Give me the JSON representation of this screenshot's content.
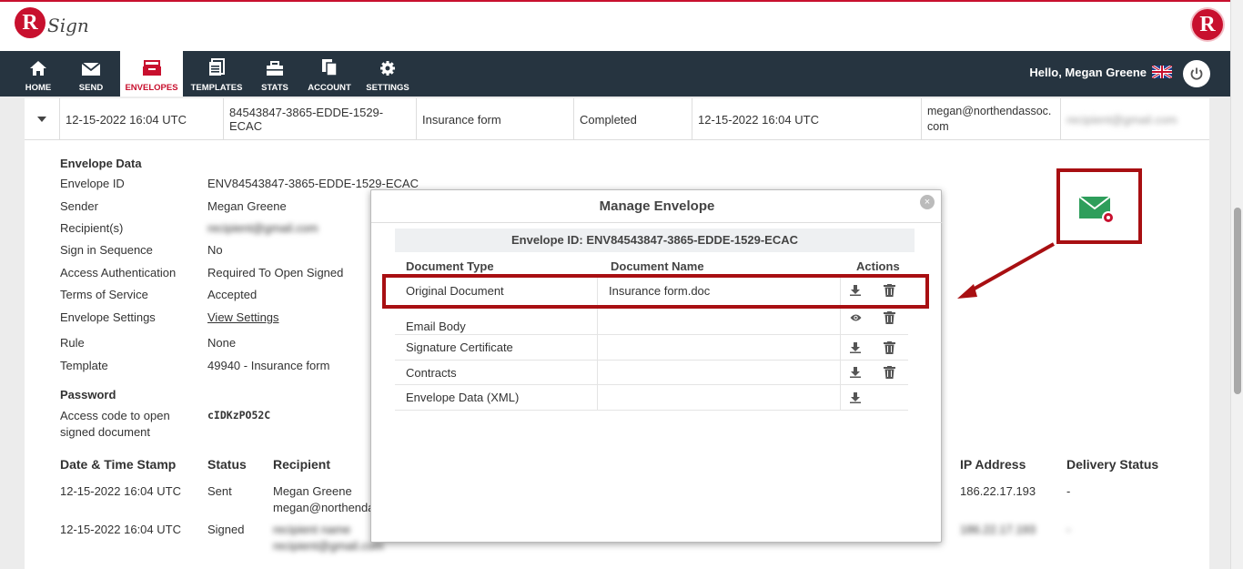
{
  "brand": {
    "logo_letter": "R",
    "logo_text": "Sign",
    "right_logo_letter": "R"
  },
  "nav": {
    "items": [
      {
        "label": "HOME"
      },
      {
        "label": "SEND"
      },
      {
        "label": "ENVELOPES"
      },
      {
        "label": "TEMPLATES"
      },
      {
        "label": "STATS"
      },
      {
        "label": "ACCOUNT"
      },
      {
        "label": "SETTINGS"
      }
    ],
    "active": "ENVELOPES",
    "greeting": "Hello, Megan Greene"
  },
  "envelope_row": {
    "created": "12-15-2022 16:04 UTC",
    "envelope_code": "84543847-3865-EDDE-1529-ECAC",
    "subject": "Insurance form",
    "status": "Completed",
    "updated": "12-15-2022 16:04 UTC",
    "sender_email": "megan@northendassoc. com",
    "recipient_email": "recipient@gmail.com"
  },
  "envelope_data": {
    "heading": "Envelope Data",
    "fields": [
      {
        "label": "Envelope ID",
        "value": "ENV84543847-3865-EDDE-1529-ECAC"
      },
      {
        "label": "Sender",
        "value": "Megan Greene"
      },
      {
        "label": "Recipient(s)",
        "value": "recipient@gmail.com"
      },
      {
        "label": "Sign in Sequence",
        "value": "No"
      },
      {
        "label": "Access Authentication",
        "value": "Required To Open Signed"
      },
      {
        "label": "Terms of Service",
        "value": "Accepted"
      },
      {
        "label": "Envelope Settings",
        "value": "View Settings"
      },
      {
        "label": "Rule",
        "value": "None"
      },
      {
        "label": "Template",
        "value": "49940 - Insurance form"
      }
    ],
    "password_heading": "Password",
    "access_code_label": "Access code to open signed document",
    "access_code_value": "cIDKzPO52C"
  },
  "history": {
    "headers": {
      "date": "Date & Time Stamp",
      "status": "Status",
      "recipient": "Recipient",
      "ip": "IP Address",
      "delivery": "Delivery Status"
    },
    "rows": [
      {
        "date": "12-15-2022 16:04 UTC",
        "status": "Sent",
        "recipient_name": "Megan Greene",
        "recipient_email": "megan@northenda",
        "ip": "186.22.17.193",
        "delivery": "-"
      },
      {
        "date": "12-15-2022 16:04 UTC",
        "status": "Signed",
        "recipient_name": "recipient name",
        "recipient_email": "recipient@gmail.com",
        "ip": "186.22.17.193",
        "delivery": "-"
      }
    ]
  },
  "modal": {
    "title": "Manage Envelope",
    "close_glyph": "×",
    "envelope_id_text": "Envelope ID: ENV84543847-3865-EDDE-1529-ECAC",
    "headers": {
      "type": "Document Type",
      "name": "Document Name",
      "actions": "Actions"
    },
    "rows": [
      {
        "type": "Original Document",
        "name": "Insurance form.doc",
        "actions": [
          "download-icon",
          "trash-icon"
        ]
      },
      {
        "type": "Email Body",
        "name": "",
        "actions": [
          "eye-icon",
          "trash-icon"
        ]
      },
      {
        "type": "Signature Certificate",
        "name": "",
        "actions": [
          "download-icon",
          "trash-icon"
        ]
      },
      {
        "type": "Contracts",
        "name": "",
        "actions": [
          "download-icon",
          "trash-icon"
        ]
      },
      {
        "type": "Envelope Data (XML)",
        "name": "",
        "actions": [
          "download-icon"
        ]
      }
    ]
  },
  "colors": {
    "brand_red": "#c8102e",
    "nav_bg": "#263440",
    "highlight": "#a80f12",
    "envelope_green": "#2e9e5b"
  }
}
